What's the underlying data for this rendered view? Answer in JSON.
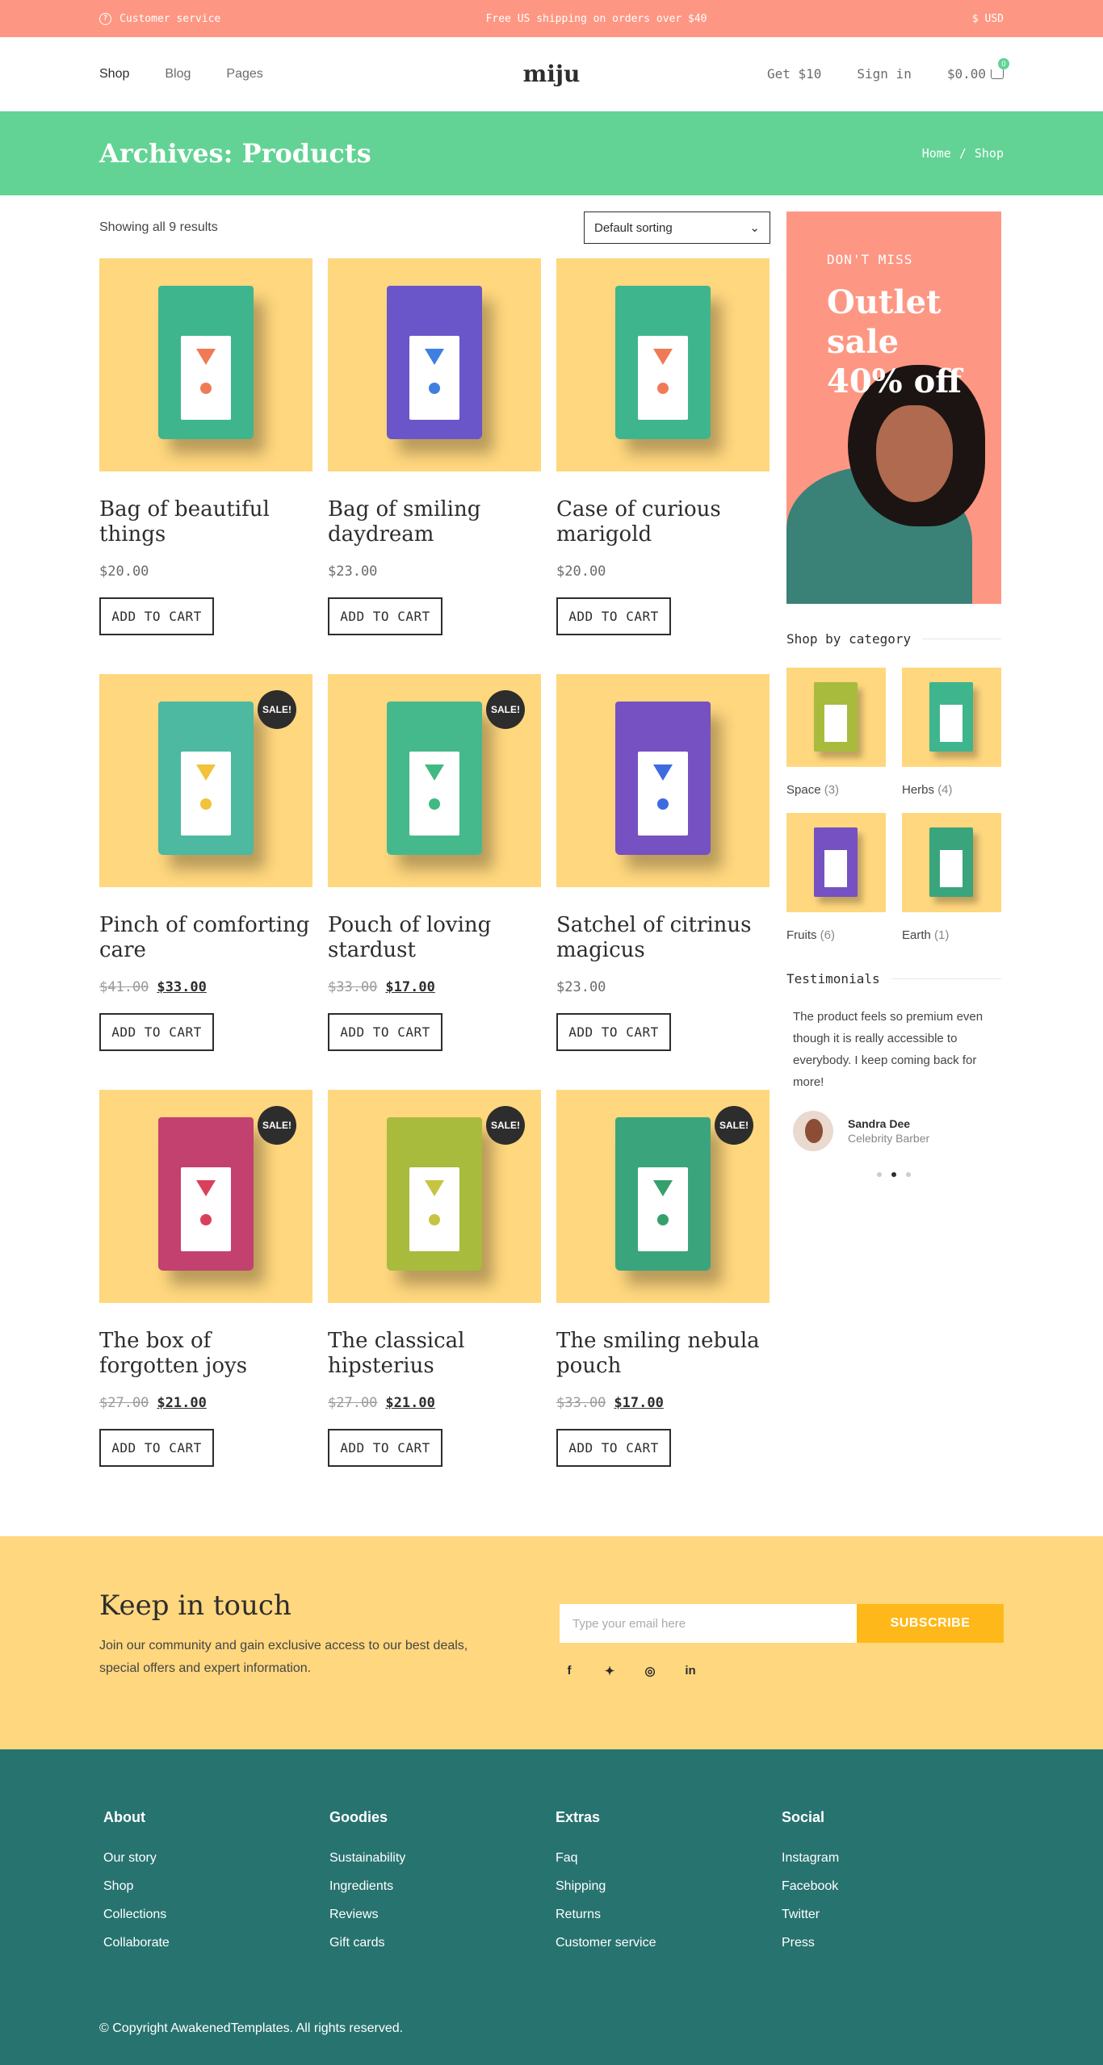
{
  "topbar": {
    "customer_service": "Customer service",
    "shipping": "Free US shipping on orders over $40",
    "currency": "$ USD"
  },
  "header": {
    "nav": [
      "Shop",
      "Blog",
      "Pages"
    ],
    "logo": "miju",
    "get_ten": "Get $10",
    "sign_in": "Sign in",
    "cart_total": "$0.00",
    "cart_count": "0"
  },
  "banner": {
    "title": "Archives: Products",
    "breadcrumb_home": "Home",
    "breadcrumb_sep": "/",
    "breadcrumb_current": "Shop"
  },
  "shop": {
    "results": "Showing all 9 results",
    "sorting": "Default sorting",
    "add_to_cart": "ADD TO CART",
    "sale_badge": "SALE!"
  },
  "products": [
    {
      "title": "Bag of beautiful things",
      "price": "$20.00",
      "old_price": "",
      "sale": false,
      "bag_color": "#3fb58e",
      "accent": "#ef7b56"
    },
    {
      "title": "Bag of smiling daydream",
      "price": "$23.00",
      "old_price": "",
      "sale": false,
      "bag_color": "#6a56c8",
      "accent": "#3f7fe0"
    },
    {
      "title": "Case of curious marigold",
      "price": "$20.00",
      "old_price": "",
      "sale": false,
      "bag_color": "#3fb58e",
      "accent": "#ef7b56"
    },
    {
      "title": "Pinch of comforting care",
      "price": "$33.00",
      "old_price": "$41.00",
      "sale": true,
      "bag_color": "#4cb9a0",
      "accent": "#f2c23b"
    },
    {
      "title": "Pouch of loving stardust",
      "price": "$17.00",
      "old_price": "$33.00",
      "sale": true,
      "bag_color": "#46b98c",
      "accent": "#41b983"
    },
    {
      "title": "Satchel of citrinus magicus",
      "price": "$23.00",
      "old_price": "",
      "sale": false,
      "bag_color": "#7651c2",
      "accent": "#3f6be0"
    },
    {
      "title": "The box of forgotten joys",
      "price": "$21.00",
      "old_price": "$27.00",
      "sale": true,
      "bag_color": "#c2416f",
      "accent": "#d9415a"
    },
    {
      "title": "The classical hipsterius",
      "price": "$21.00",
      "old_price": "$27.00",
      "sale": true,
      "bag_color": "#a9bb3d",
      "accent": "#c7c444"
    },
    {
      "title": "The smiling nebula pouch",
      "price": "$17.00",
      "old_price": "$33.00",
      "sale": true,
      "bag_color": "#3aa57c",
      "accent": "#36a06c"
    }
  ],
  "sidebar": {
    "promo_kicker": "DON'T MISS",
    "promo_title": "Outlet sale 40% off",
    "categories_heading": "Shop by category",
    "categories": [
      {
        "name": "Space",
        "count": "(3)",
        "bag_color": "#a9bb3d"
      },
      {
        "name": "Herbs",
        "count": "(4)",
        "bag_color": "#3fb58e"
      },
      {
        "name": "Fruits",
        "count": "(6)",
        "bag_color": "#7651c2"
      },
      {
        "name": "Earth",
        "count": "(1)",
        "bag_color": "#3aa57c"
      }
    ],
    "testimonials_heading": "Testimonials",
    "quote": "The product feels so premium even though it is really accessible to everybody. I keep coming back for more!",
    "author_name": "Sandra Dee",
    "author_role": "Celebrity Barber"
  },
  "newsletter": {
    "title": "Keep in touch",
    "text": "Join our community and gain exclusive access to our best deals, special offers and expert information.",
    "placeholder": "Type your email here",
    "button": "SUBSCRIBE",
    "socials": [
      "facebook-icon",
      "twitter-icon",
      "instagram-icon",
      "linkedin-icon"
    ]
  },
  "footer": {
    "columns": [
      {
        "title": "About",
        "links": [
          "Our story",
          "Shop",
          "Collections",
          "Collaborate"
        ]
      },
      {
        "title": "Goodies",
        "links": [
          "Sustainability",
          "Ingredients",
          "Reviews",
          "Gift cards"
        ]
      },
      {
        "title": "Extras",
        "links": [
          "Faq",
          "Shipping",
          "Returns",
          "Customer service"
        ]
      },
      {
        "title": "Social",
        "links": [
          "Instagram",
          "Facebook",
          "Twitter",
          "Press"
        ]
      }
    ],
    "copyright": "© Copyright AwakenedTemplates. All rights reserved."
  },
  "colors": {
    "topbar": "#fd9783",
    "banner": "#62d394",
    "product_bg": "#ffd77e",
    "subscribe": "#ffb81a",
    "footer": "#277370"
  }
}
